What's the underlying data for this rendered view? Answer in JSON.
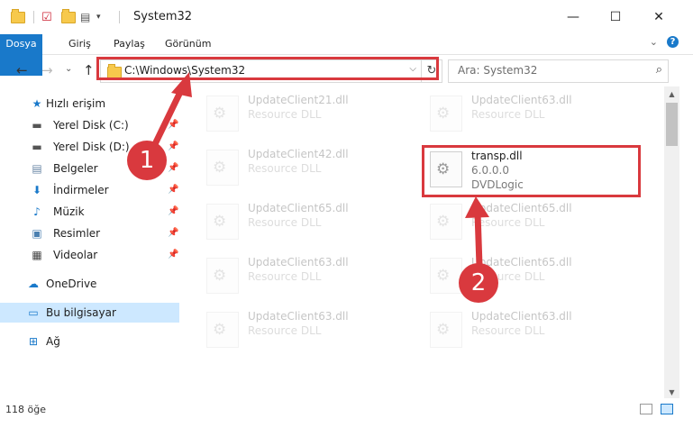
{
  "window": {
    "title": "System32",
    "minimize": "—",
    "maximize": "☐",
    "close": "✕"
  },
  "ribbon": {
    "tabs": [
      "Dosya",
      "Giriş",
      "Paylaş",
      "Görünüm"
    ],
    "expand": "⌄",
    "help": "?"
  },
  "address": {
    "path": "C:\\Windows\\System32",
    "dropdown": "⌵",
    "refresh": "↻"
  },
  "search": {
    "placeholder": "Ara: System32",
    "icon": "⌕"
  },
  "nav": {
    "back": "←",
    "forward": "→",
    "recent": "⌄",
    "up": "↑"
  },
  "sidebar": {
    "items": [
      {
        "label": "Hızlı erişim",
        "icon": "star-icon"
      },
      {
        "label": "Yerel Disk (C:)",
        "icon": "drive-icon"
      },
      {
        "label": "Yerel Disk (D:)",
        "icon": "drive-icon"
      },
      {
        "label": "Belgeler",
        "icon": "documents-icon"
      },
      {
        "label": "İndirmeler",
        "icon": "download-icon"
      },
      {
        "label": "Müzik",
        "icon": "music-icon"
      },
      {
        "label": "Resimler",
        "icon": "pictures-icon"
      },
      {
        "label": "Videolar",
        "icon": "videos-icon"
      },
      {
        "label": "OneDrive",
        "icon": "cloud-icon"
      },
      {
        "label": "Bu bilgisayar",
        "icon": "computer-icon"
      },
      {
        "label": "Ağ",
        "icon": "network-icon"
      }
    ]
  },
  "files": {
    "left": [
      {
        "name": "UpdateClient21.dll",
        "type": "Resource DLL"
      },
      {
        "name": "UpdateClient42.dll",
        "type": "Resource DLL"
      },
      {
        "name": "UpdateClient65.dll",
        "type": "Resource DLL"
      },
      {
        "name": "UpdateClient63.dll",
        "type": "Resource DLL"
      },
      {
        "name": "UpdateClient63.dll",
        "type": "Resource DLL"
      }
    ],
    "right": [
      {
        "name": "UpdateClient63.dll",
        "type": "Resource DLL"
      },
      {
        "name": "UpdateClient65.dll",
        "type": "Resource DLL"
      },
      {
        "name": "UpdateClient65.dll",
        "type": "Resource DLL"
      },
      {
        "name": "UpdateClient63.dll",
        "type": "Resource DLL"
      }
    ],
    "selected": {
      "name": "transp.dll",
      "version": "6.0.0.0",
      "company": "DVDLogic"
    }
  },
  "status": {
    "count": "118 öğe"
  },
  "markers": [
    "1",
    "2"
  ],
  "colors": {
    "accent": "#1979ca",
    "highlight": "#d9393e",
    "selected_bg": "#cde8ff"
  }
}
